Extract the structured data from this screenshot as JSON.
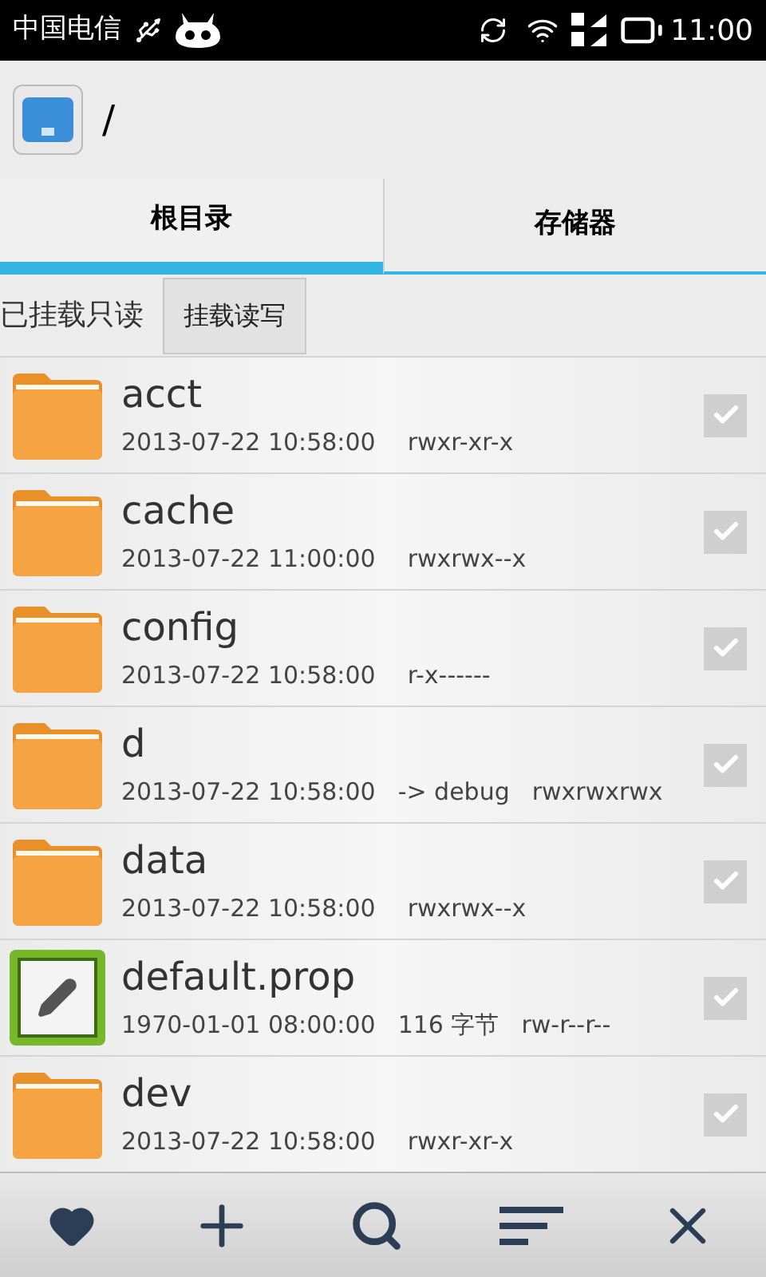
{
  "status_bar": {
    "carrier": "中国电信",
    "time": "11:00"
  },
  "header": {
    "path": "/"
  },
  "tabs": [
    {
      "label": "根目录",
      "selected": true
    },
    {
      "label": "存储器",
      "selected": false
    }
  ],
  "mount": {
    "status": "已挂载只读",
    "button": "挂载读写"
  },
  "files": [
    {
      "kind": "folder",
      "name": "acct",
      "date": "2013-07-22 10:58:00",
      "perms": "rwxr-xr-x",
      "checked": false
    },
    {
      "kind": "folder",
      "name": "cache",
      "date": "2013-07-22 11:00:00",
      "perms": "rwxrwx--x",
      "checked": false
    },
    {
      "kind": "folder",
      "name": "config",
      "date": "2013-07-22 10:58:00",
      "perms": "r-x------",
      "checked": false
    },
    {
      "kind": "folder",
      "name": "d",
      "date": "2013-07-22 10:58:00",
      "detail": "-> debug",
      "perms": "rwxrwxrwx",
      "checked": false
    },
    {
      "kind": "folder",
      "name": "data",
      "date": "2013-07-22 10:58:00",
      "perms": "rwxrwx--x",
      "checked": false
    },
    {
      "kind": "file",
      "name": "default.prop",
      "date": "1970-01-01 08:00:00",
      "detail": "116 字节",
      "perms": "rw-r--r--",
      "checked": false
    },
    {
      "kind": "folder",
      "name": "dev",
      "date": "2013-07-22 10:58:00",
      "perms": "rwxr-xr-x",
      "checked": false
    }
  ]
}
